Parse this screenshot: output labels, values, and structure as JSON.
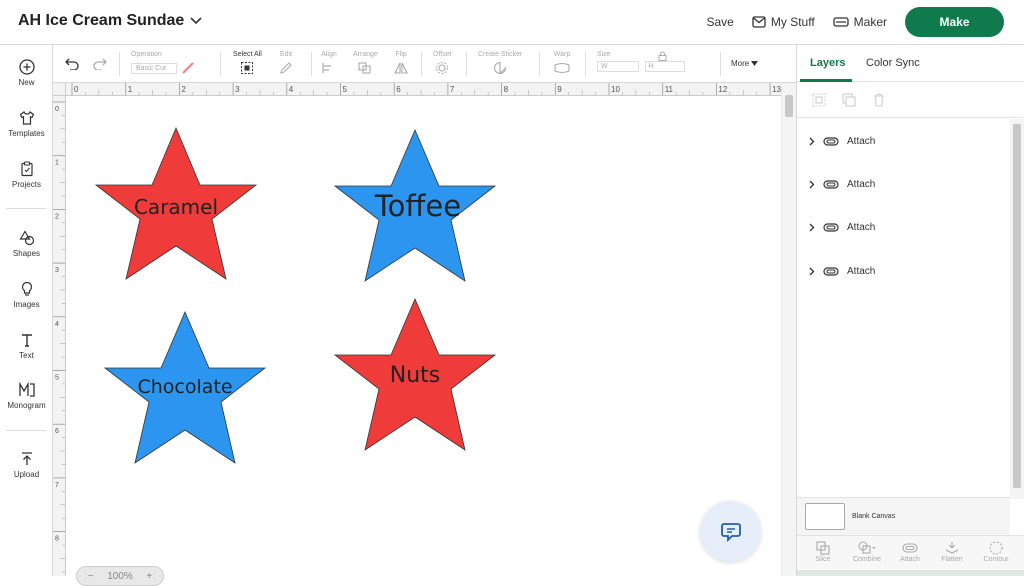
{
  "header": {
    "project_title": "AH Ice Cream Sundae",
    "save_label": "Save",
    "my_stuff_label": "My Stuff",
    "maker_label": "Maker",
    "make_label": "Make"
  },
  "left_nav": {
    "items": [
      {
        "label": "New",
        "icon": "plus-circle-icon"
      },
      {
        "label": "Templates",
        "icon": "tshirt-icon"
      },
      {
        "label": "Projects",
        "icon": "clipboard-icon"
      },
      {
        "label": "Shapes",
        "icon": "shapes-icon"
      },
      {
        "label": "Images",
        "icon": "lightbulb-icon"
      },
      {
        "label": "Text",
        "icon": "text-icon"
      },
      {
        "label": "Monogram",
        "icon": "monogram-icon"
      },
      {
        "label": "Upload",
        "icon": "upload-icon"
      }
    ]
  },
  "toolbar": {
    "operation_label": "Operation",
    "operation_value": "Basic Cut",
    "select_all_label": "Select All",
    "edit_label": "Edit",
    "align_label": "Align",
    "arrange_label": "Arrange",
    "flip_label": "Flip",
    "offset_label": "Offset",
    "create_sticker_label": "Create Sticker",
    "warp_label": "Warp",
    "size_label": "Size",
    "size_w": "W",
    "size_h": "H",
    "more_label": "More"
  },
  "ruler": {
    "top_ticks": [
      "0",
      "1",
      "2",
      "3",
      "4",
      "5",
      "6",
      "7",
      "8",
      "9",
      "10",
      "11",
      "12",
      "13"
    ],
    "left_ticks": [
      "0",
      "1",
      "2",
      "3",
      "4",
      "5",
      "6",
      "7",
      "8"
    ]
  },
  "canvas": {
    "stars": [
      {
        "label": "Caramel",
        "color": "#f03b3b"
      },
      {
        "label": "Toffee",
        "color": "#2b95ef"
      },
      {
        "label": "Chocolate",
        "color": "#2b95ef"
      },
      {
        "label": "Nuts",
        "color": "#f03b3b"
      }
    ],
    "zoom_value": "100%"
  },
  "right_panel": {
    "tab_layers": "Layers",
    "tab_color_sync": "Color Sync",
    "layers": [
      {
        "label": "Attach"
      },
      {
        "label": "Attach"
      },
      {
        "label": "Attach"
      },
      {
        "label": "Attach"
      }
    ],
    "blank_canvas_label": "Blank Canvas",
    "bottom_tools": [
      "Slice",
      "Combine",
      "Attach",
      "Flatten",
      "Contour"
    ]
  },
  "colors": {
    "brand_green": "#0f7a4b",
    "star_red": "#f03b3b",
    "star_blue": "#2b95ef"
  }
}
